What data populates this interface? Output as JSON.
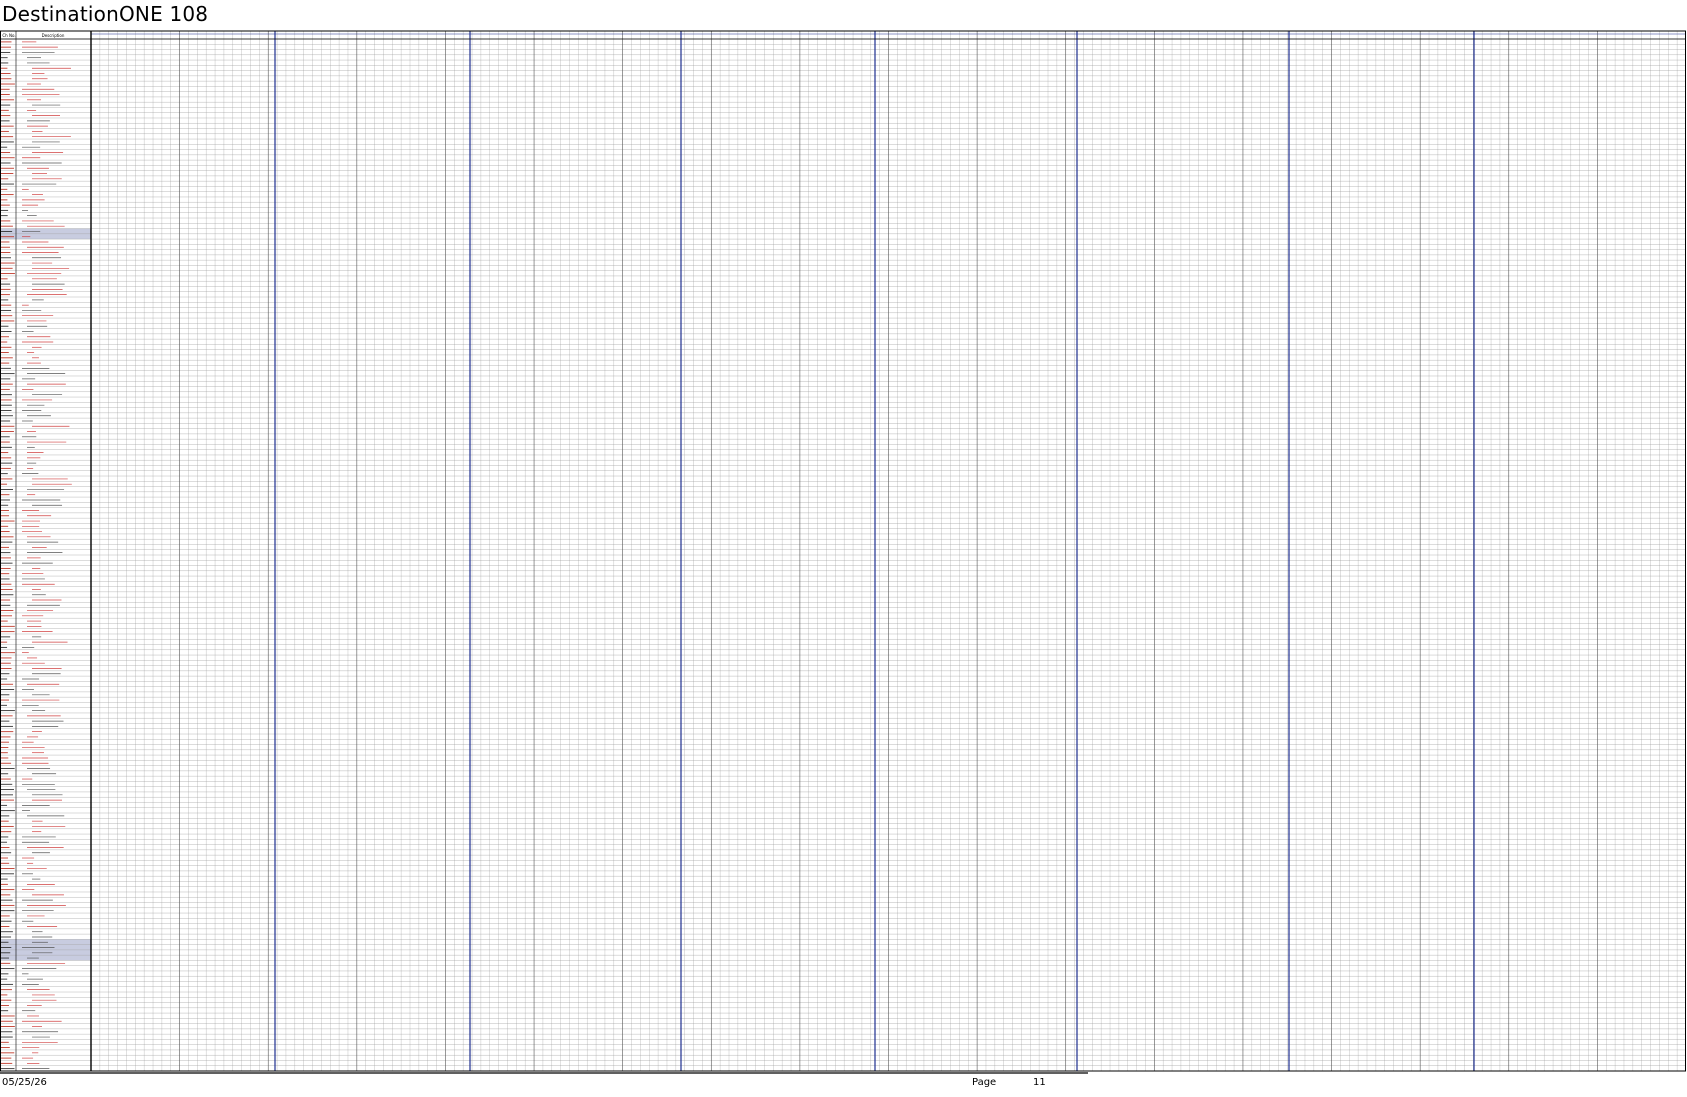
{
  "document": {
    "title": "DestinationONE 108"
  },
  "table": {
    "headers": [
      "Ch No.",
      "Description"
    ],
    "row_count": 196,
    "time_group_count": 18,
    "colors": {
      "row_code_red": "#c0392b",
      "row_code_black": "#333333",
      "row_desc_red": "#d04040",
      "row_desc_black": "#555555",
      "section_band": "#c8cce0",
      "header_rule": "#1e2f8f",
      "grid_line": "#9a9a9a",
      "frame": "#000000"
    }
  },
  "footer": {
    "date": "05/25/26",
    "page_label": "Page",
    "page_number": "11"
  }
}
